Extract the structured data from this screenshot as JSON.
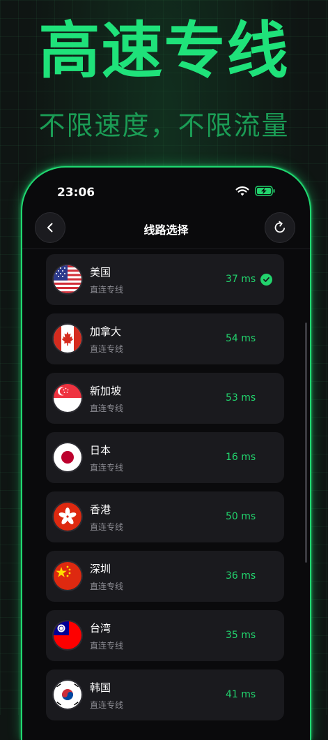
{
  "hero": {
    "title": "高速专线",
    "subtitle": "不限速度，不限流量"
  },
  "status_bar": {
    "time": "23:06"
  },
  "nav": {
    "title": "线路选择",
    "back_icon": "chevron-left-icon",
    "refresh_icon": "refresh-icon"
  },
  "colors": {
    "accent": "#22d36d",
    "hero": "#1fe27a",
    "card": "#1a1a1e"
  },
  "routes": [
    {
      "name": "美国",
      "type": "直连专线",
      "ping": "37 ms",
      "selected": true,
      "flag": "us"
    },
    {
      "name": "加拿大",
      "type": "直连专线",
      "ping": "54 ms",
      "selected": false,
      "flag": "ca"
    },
    {
      "name": "新加坡",
      "type": "直连专线",
      "ping": "53 ms",
      "selected": false,
      "flag": "sg"
    },
    {
      "name": "日本",
      "type": "直连专线",
      "ping": "16 ms",
      "selected": false,
      "flag": "jp"
    },
    {
      "name": "香港",
      "type": "直连专线",
      "ping": "50 ms",
      "selected": false,
      "flag": "hk"
    },
    {
      "name": "深圳",
      "type": "直连专线",
      "ping": "36 ms",
      "selected": false,
      "flag": "cn"
    },
    {
      "name": "台湾",
      "type": "直连专线",
      "ping": "35 ms",
      "selected": false,
      "flag": "tw"
    },
    {
      "name": "韩国",
      "type": "直连专线",
      "ping": "41 ms",
      "selected": false,
      "flag": "kr"
    }
  ]
}
